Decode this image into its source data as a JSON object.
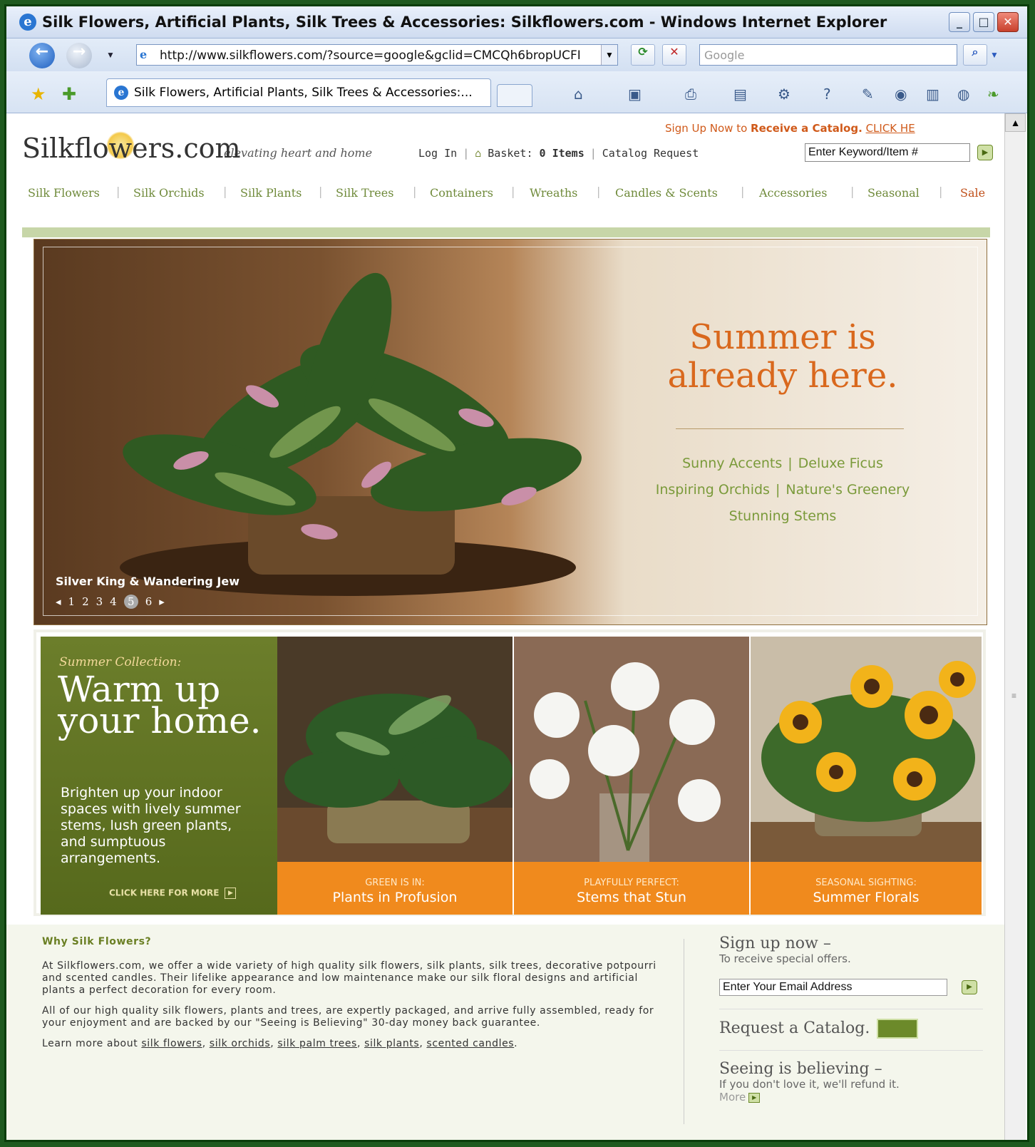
{
  "browser": {
    "title": "Silk Flowers, Artificial Plants, Silk Trees & Accessories: Silkflowers.com - Windows Internet Explorer",
    "url": "http://www.silkflowers.com/?source=google&gclid=CMCQh6bropUCFI",
    "search_placeholder": "Google",
    "tab_title": "Silk Flowers, Artificial Plants, Silk Trees & Accessories:...",
    "minimize": "_",
    "maximize": "□",
    "close": "✕"
  },
  "header": {
    "logo": "Silkflowers.com",
    "tagline": "elevating heart and home",
    "signup_prefix": "Sign Up Now to",
    "signup_bold": "Receive a Catalog.",
    "signup_link": "CLICK HE",
    "login": "Log In",
    "basket_label": "Basket:",
    "basket_count": "0 Items",
    "catalog_request": "Catalog Request",
    "keyword_value": "Enter Keyword/Item #"
  },
  "nav": {
    "items": [
      "Silk Flowers",
      "Silk Orchids",
      "Silk Plants",
      "Silk Trees",
      "Containers",
      "Wreaths",
      "Candles & Scents",
      "Accessories",
      "Seasonal",
      "Sale"
    ]
  },
  "hero": {
    "headline_line1": "Summer is",
    "headline_line2": "already here.",
    "links": [
      "Sunny Accents",
      "Deluxe Ficus",
      "Inspiring Orchids",
      "Nature's Greenery",
      "Stunning Stems"
    ],
    "caption": "Silver King & Wandering Jew",
    "pager": [
      "◂",
      "1",
      "2",
      "3",
      "4",
      "5",
      "6",
      "▸"
    ]
  },
  "summer": {
    "kicker": "Summer Collection:",
    "headline": "Warm up your home.",
    "body": "Brighten up your indoor spaces with lively summer stems, lush green plants, and sumptuous arrangements.",
    "more": "CLICK HERE FOR MORE",
    "tiles": [
      {
        "kicker": "GREEN IS IN:",
        "title": "Plants in Profusion"
      },
      {
        "kicker": "PLAYFULLY PERFECT:",
        "title": "Stems that Stun"
      },
      {
        "kicker": "SEASONAL SIGHTING:",
        "title": "Summer Florals"
      }
    ]
  },
  "why": {
    "heading": "Why Silk Flowers?",
    "p1": "At Silkflowers.com, we offer a wide variety of high quality silk flowers, silk plants, silk trees, decorative potpourri and scented candles. Their lifelike appearance and low maintenance make our silk floral designs and artificial plants a perfect decoration for every room.",
    "p2": "All of our high quality silk flowers, plants and trees, are expertly packaged, and arrive fully assembled, ready for your enjoyment and are backed by our \"Seeing is Believing\" 30-day money back guarantee.",
    "learn_prefix": "Learn more about",
    "learn_links": [
      "silk flowers",
      "silk orchids",
      "silk palm trees",
      "silk plants",
      "scented candles"
    ]
  },
  "sidebar": {
    "signup_heading": "Sign up now –",
    "signup_sub": "To receive special offers.",
    "email_value": "Enter Your Email Address",
    "catalog": "Request a Catalog.",
    "seeing_heading": "Seeing is believing –",
    "seeing_sub": "If you don't love it, we'll refund it.",
    "more": "More"
  }
}
